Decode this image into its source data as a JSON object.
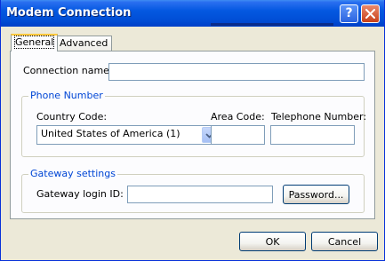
{
  "window": {
    "title": "Modem Connection",
    "help_glyph": "?"
  },
  "tabs": [
    {
      "label": "General",
      "selected": true
    },
    {
      "label": "Advanced",
      "selected": false
    }
  ],
  "general": {
    "connection_name_label": "Connection name:",
    "connection_name_value": "",
    "phone_number": {
      "title": "Phone Number",
      "country_code_label": "Country Code:",
      "country_code_value": "United States of America (1)",
      "area_code_label": "Area Code:",
      "area_code_value": "",
      "telephone_label": "Telephone Number:",
      "telephone_value": ""
    },
    "gateway": {
      "title": "Gateway settings",
      "login_label": "Gateway login ID:",
      "login_value": "",
      "password_button": "Password..."
    }
  },
  "footer": {
    "ok_label": "OK",
    "cancel_label": "Cancel"
  },
  "colors": {
    "titlebar": "#0458e1",
    "dialog_bg": "#ece9d8",
    "panel_bg": "#fcfcfe",
    "group_title": "#0046d5",
    "selection": "#316ac5",
    "tab_highlight": "#ffc83c"
  }
}
